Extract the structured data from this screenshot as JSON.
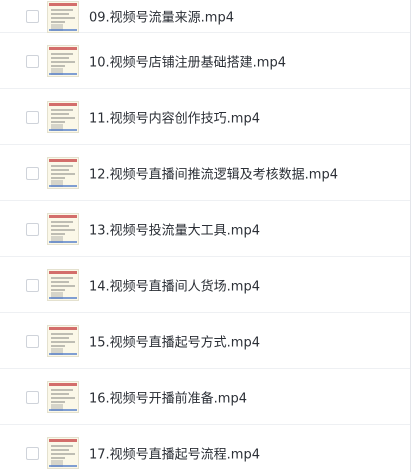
{
  "files": [
    {
      "name": "09.视频号流量来源.mp4"
    },
    {
      "name": "10.视频号店铺注册基础搭建.mp4"
    },
    {
      "name": "11.视频号内容创作技巧.mp4"
    },
    {
      "name": "12.视频号直播间推流逻辑及考核数据.mp4"
    },
    {
      "name": "13.视频号投流量大工具.mp4"
    },
    {
      "name": "14.视频号直播间人货场.mp4"
    },
    {
      "name": "15.视频号直播起号方式.mp4"
    },
    {
      "name": "16.视频号开播前准备.mp4"
    },
    {
      "name": "17.视频号直播起号流程.mp4"
    }
  ]
}
